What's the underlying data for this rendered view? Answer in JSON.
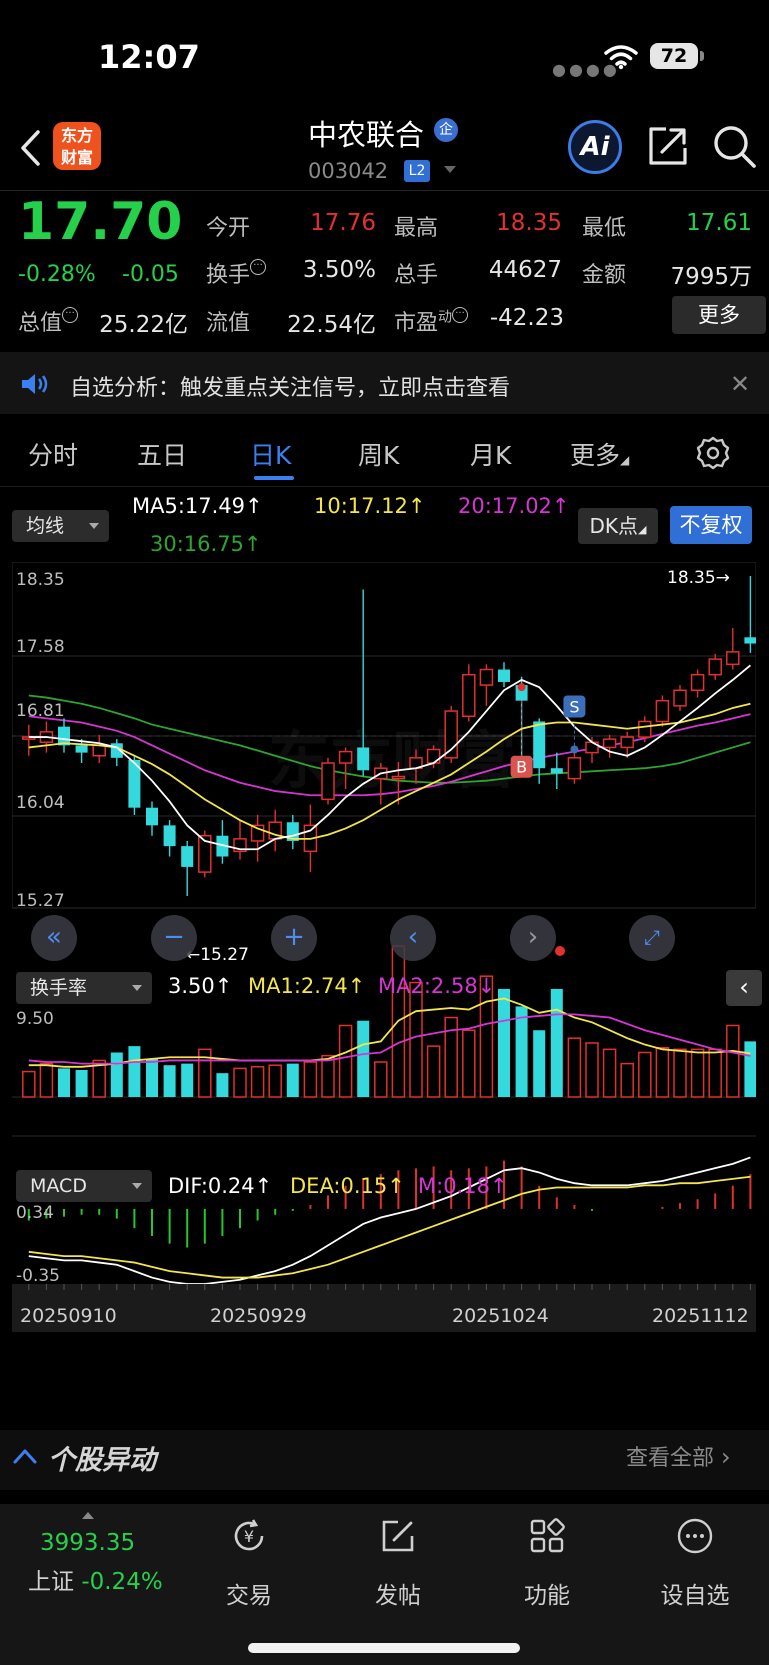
{
  "status_bar": {
    "time": "12:07",
    "battery": "72"
  },
  "header": {
    "logo_text_1": "东方",
    "logo_text_2": "财富",
    "stock_name": "中农联合",
    "name_badge": "企",
    "stock_code": "003042",
    "level_badge": "L2",
    "ai_label": "Ai"
  },
  "quote": {
    "price": "17.70",
    "change_pct": "-0.28%",
    "change": "-0.05",
    "open_label": "今开",
    "open": "17.76",
    "high_label": "最高",
    "high": "18.35",
    "low_label": "最低",
    "low": "17.61",
    "turnover_label": "换手",
    "turnover": "3.50%",
    "volume_label": "总手",
    "volume": "44627",
    "amount_label": "金额",
    "amount": "7995万",
    "mktcap_label": "总值",
    "mktcap": "25.22亿",
    "float_label": "流值",
    "float_cap": "22.54亿",
    "pe_label": "市盈",
    "pe_super": "动",
    "pe": "-42.23",
    "more_label": "更多"
  },
  "notice": {
    "text": "自选分析：触发重点关注信号，立即点击查看"
  },
  "tabs": [
    {
      "label": "分时",
      "active": false
    },
    {
      "label": "五日",
      "active": false
    },
    {
      "label": "日K",
      "active": true
    },
    {
      "label": "周K",
      "active": false
    },
    {
      "label": "月K",
      "active": false
    },
    {
      "label": "更多",
      "active": false
    }
  ],
  "indicators": {
    "main_select": "均线",
    "ma5": "MA5:17.49↑",
    "ma10": "10:17.12↑",
    "ma20": "20:17.02↑",
    "ma30": "30:16.75↑",
    "dk_label": "DK点",
    "fq_label": "不复权",
    "sub1_select": "换手率",
    "sub1_val": "3.50↑",
    "sub1_ma1": "MA1:2.74↑",
    "sub1_ma2": "MA2:2.58↓",
    "sub2_select": "MACD",
    "dif": "DIF:0.24↑",
    "dea": "DEA:0.15↑",
    "m": "M:0.18↑"
  },
  "colors": {
    "up": "#e0312f",
    "down": "#33d9dd",
    "ma5": "#ffffff",
    "ma10": "#f4e64a",
    "ma20": "#d536d3",
    "ma30": "#2ea52e",
    "accent": "#2f6fd6",
    "green_text": "#25d04a"
  },
  "chart_data": {
    "type": "candlestick",
    "title": "中农联合 日K",
    "price_axis": {
      "ticks": [
        "18.35",
        "17.58",
        "16.81",
        "16.04",
        "15.27"
      ],
      "ylim": [
        15.27,
        18.35
      ]
    },
    "max_label": "18.35→",
    "min_label": "←15.27",
    "dates": [
      "20250910",
      "20250929",
      "20251024",
      "20251112"
    ],
    "watermark": "东方财富",
    "markers": {
      "buy": "B",
      "sell": "S"
    },
    "candles": [
      [
        16.78,
        16.8,
        16.62,
        16.92
      ],
      [
        16.75,
        16.85,
        16.65,
        16.95
      ],
      [
        16.9,
        16.72,
        16.65,
        16.98
      ],
      [
        16.72,
        16.65,
        16.55,
        16.78
      ],
      [
        16.62,
        16.72,
        16.55,
        16.82
      ],
      [
        16.74,
        16.6,
        16.52,
        16.78
      ],
      [
        16.58,
        16.12,
        16.05,
        16.62
      ],
      [
        16.12,
        15.95,
        15.85,
        16.18
      ],
      [
        15.95,
        15.75,
        15.65,
        16.0
      ],
      [
        15.75,
        15.55,
        15.27,
        15.8
      ],
      [
        15.5,
        15.85,
        15.45,
        15.9
      ],
      [
        15.85,
        15.65,
        15.58,
        16.0
      ],
      [
        15.7,
        15.82,
        15.62,
        16.0
      ],
      [
        15.8,
        15.95,
        15.6,
        16.05
      ],
      [
        15.82,
        15.98,
        15.7,
        16.1
      ],
      [
        15.98,
        15.8,
        15.72,
        16.05
      ],
      [
        15.7,
        15.95,
        15.5,
        16.15
      ],
      [
        16.2,
        16.55,
        16.15,
        16.6
      ],
      [
        16.55,
        16.66,
        16.3,
        16.7
      ],
      [
        16.7,
        16.48,
        16.42,
        18.22
      ],
      [
        16.4,
        16.5,
        16.15,
        16.55
      ],
      [
        16.4,
        16.42,
        16.15,
        16.56
      ],
      [
        16.5,
        16.6,
        16.35,
        16.68
      ],
      [
        16.55,
        16.68,
        16.5,
        16.72
      ],
      [
        16.6,
        17.05,
        16.55,
        17.1
      ],
      [
        17.0,
        17.4,
        16.95,
        17.5
      ],
      [
        17.3,
        17.45,
        17.1,
        17.5
      ],
      [
        17.45,
        17.33,
        17.28,
        17.52
      ],
      [
        17.3,
        17.15,
        16.6,
        17.38
      ],
      [
        16.95,
        16.5,
        16.35,
        16.98
      ],
      [
        16.5,
        16.45,
        16.3,
        16.65
      ],
      [
        16.4,
        16.6,
        16.35,
        16.65
      ],
      [
        16.65,
        16.75,
        16.55,
        16.8
      ],
      [
        16.7,
        16.78,
        16.6,
        16.82
      ],
      [
        16.7,
        16.8,
        16.6,
        16.85
      ],
      [
        16.8,
        16.95,
        16.75,
        17.0
      ],
      [
        16.95,
        17.15,
        16.9,
        17.2
      ],
      [
        17.1,
        17.25,
        17.05,
        17.3
      ],
      [
        17.25,
        17.4,
        17.18,
        17.45
      ],
      [
        17.4,
        17.55,
        17.35,
        17.6
      ],
      [
        17.5,
        17.62,
        17.45,
        17.85
      ],
      [
        17.76,
        17.7,
        17.61,
        18.35
      ]
    ],
    "ma": {
      "ma5": [
        16.8,
        16.8,
        16.78,
        16.76,
        16.74,
        16.7,
        16.55,
        16.38,
        16.18,
        15.95,
        15.8,
        15.76,
        15.72,
        15.72,
        15.82,
        15.85,
        15.9,
        16.05,
        16.22,
        16.35,
        16.45,
        16.48,
        16.5,
        16.55,
        16.68,
        16.85,
        17.05,
        17.25,
        17.35,
        17.28,
        17.1,
        16.9,
        16.75,
        16.66,
        16.62,
        16.7,
        16.82,
        16.95,
        17.08,
        17.22,
        17.35,
        17.49
      ],
      "ma10": [
        16.7,
        16.72,
        16.74,
        16.73,
        16.72,
        16.7,
        16.62,
        16.54,
        16.44,
        16.32,
        16.2,
        16.1,
        16.0,
        15.92,
        15.86,
        15.82,
        15.82,
        15.86,
        15.92,
        16.0,
        16.1,
        16.2,
        16.28,
        16.36,
        16.44,
        16.55,
        16.66,
        16.78,
        16.88,
        16.92,
        16.94,
        16.94,
        16.92,
        16.9,
        16.88,
        16.9,
        16.92,
        16.94,
        16.98,
        17.02,
        17.08,
        17.12
      ],
      "ma20": [
        17.0,
        16.98,
        16.96,
        16.94,
        16.9,
        16.86,
        16.8,
        16.72,
        16.64,
        16.56,
        16.48,
        16.42,
        16.36,
        16.32,
        16.28,
        16.26,
        16.24,
        16.24,
        16.24,
        16.24,
        16.25,
        16.27,
        16.3,
        16.33,
        16.37,
        16.42,
        16.47,
        16.52,
        16.56,
        16.6,
        16.63,
        16.66,
        16.69,
        16.72,
        16.75,
        16.79,
        16.83,
        16.87,
        16.91,
        16.94,
        16.98,
        17.02
      ],
      "ma30": [
        17.2,
        17.18,
        17.15,
        17.12,
        17.08,
        17.03,
        16.98,
        16.92,
        16.88,
        16.84,
        16.8,
        16.76,
        16.72,
        16.67,
        16.62,
        16.57,
        16.52,
        16.48,
        16.45,
        16.42,
        16.4,
        16.38,
        16.37,
        16.36,
        16.36,
        16.37,
        16.38,
        16.4,
        16.42,
        16.44,
        16.45,
        16.46,
        16.47,
        16.48,
        16.49,
        16.5,
        16.52,
        16.55,
        16.6,
        16.65,
        16.7,
        16.75
      ]
    },
    "turnover": {
      "axis_max": "9.50",
      "bars": [
        1.6,
        2.1,
        1.8,
        1.7,
        2.3,
        2.8,
        3.2,
        2.4,
        2.0,
        2.1,
        3.0,
        1.5,
        1.8,
        1.9,
        2.0,
        2.1,
        2.2,
        2.6,
        4.5,
        4.8,
        2.2,
        9.5,
        7.2,
        3.2,
        5.0,
        4.2,
        7.6,
        6.8,
        5.7,
        4.2,
        6.8,
        3.7,
        3.4,
        3.0,
        2.1,
        2.8,
        3.1,
        3.0,
        3.0,
        3.0,
        4.5,
        3.5
      ],
      "ma1": [
        2.0,
        2.0,
        1.9,
        1.9,
        2.0,
        2.1,
        2.3,
        2.4,
        2.5,
        2.5,
        2.5,
        2.4,
        2.3,
        2.3,
        2.3,
        2.3,
        2.3,
        2.4,
        2.8,
        3.3,
        3.5,
        4.8,
        5.4,
        5.5,
        5.6,
        5.5,
        6.0,
        6.2,
        5.8,
        5.3,
        5.5,
        5.0,
        4.7,
        4.2,
        3.7,
        3.3,
        3.0,
        2.9,
        2.8,
        2.8,
        2.9,
        2.74
      ],
      "ma2": [
        2.3,
        2.2,
        2.2,
        2.1,
        2.1,
        2.1,
        2.2,
        2.2,
        2.3,
        2.3,
        2.3,
        2.3,
        2.3,
        2.3,
        2.3,
        2.3,
        2.3,
        2.3,
        2.5,
        2.7,
        2.8,
        3.4,
        3.8,
        4.0,
        4.2,
        4.3,
        4.6,
        4.8,
        5.0,
        5.1,
        5.2,
        5.2,
        5.1,
        5.0,
        4.6,
        4.2,
        3.9,
        3.6,
        3.3,
        3.0,
        2.8,
        2.58
      ]
    },
    "macd": {
      "axis_top": "0.34",
      "axis_bottom": "-0.35",
      "hist": [
        -0.06,
        -0.05,
        -0.04,
        -0.03,
        -0.03,
        -0.05,
        -0.1,
        -0.14,
        -0.18,
        -0.2,
        -0.18,
        -0.14,
        -0.1,
        -0.06,
        -0.03,
        -0.01,
        0.02,
        0.07,
        0.12,
        0.16,
        0.18,
        0.2,
        0.21,
        0.22,
        0.2,
        0.21,
        0.22,
        0.25,
        0.22,
        0.12,
        0.06,
        0.02,
        -0.01,
        0.0,
        0.0,
        0.0,
        0.01,
        0.03,
        0.05,
        0.08,
        0.12,
        0.18
      ],
      "dif": [
        -0.22,
        -0.23,
        -0.24,
        -0.24,
        -0.25,
        -0.26,
        -0.29,
        -0.32,
        -0.34,
        -0.35,
        -0.35,
        -0.34,
        -0.33,
        -0.31,
        -0.29,
        -0.26,
        -0.22,
        -0.17,
        -0.12,
        -0.07,
        -0.04,
        -0.02,
        0.0,
        0.03,
        0.06,
        0.1,
        0.14,
        0.18,
        0.19,
        0.17,
        0.14,
        0.12,
        0.11,
        0.11,
        0.11,
        0.12,
        0.13,
        0.15,
        0.17,
        0.19,
        0.21,
        0.24
      ],
      "dea": [
        -0.2,
        -0.21,
        -0.22,
        -0.22,
        -0.23,
        -0.24,
        -0.25,
        -0.27,
        -0.29,
        -0.3,
        -0.31,
        -0.32,
        -0.32,
        -0.32,
        -0.31,
        -0.3,
        -0.28,
        -0.26,
        -0.23,
        -0.2,
        -0.17,
        -0.14,
        -0.11,
        -0.08,
        -0.05,
        -0.02,
        0.01,
        0.04,
        0.07,
        0.09,
        0.1,
        0.1,
        0.1,
        0.1,
        0.1,
        0.11,
        0.11,
        0.12,
        0.12,
        0.13,
        0.14,
        0.15
      ],
      "ylim": [
        -0.35,
        0.34
      ]
    }
  },
  "section": {
    "title": "个股异动",
    "more": "查看全部"
  },
  "bottom_nav": {
    "index_value": "3993.35",
    "index_name": "上证",
    "index_pct": "-0.24%",
    "items": [
      "交易",
      "发帖",
      "功能",
      "设自选"
    ]
  }
}
